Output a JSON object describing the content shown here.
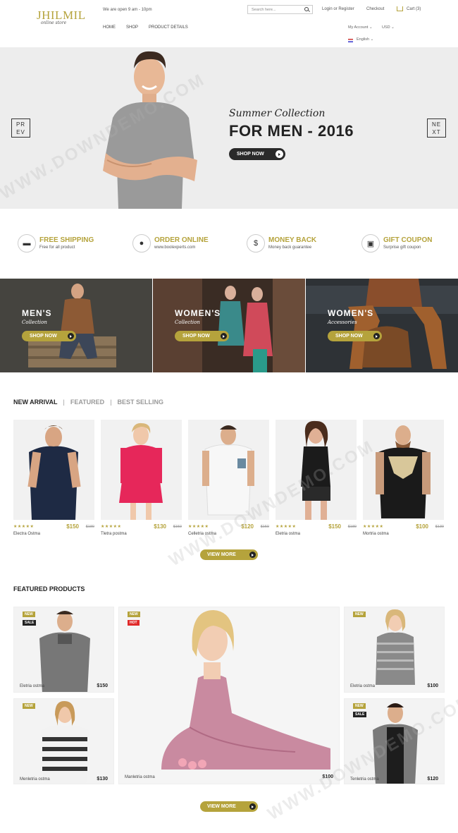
{
  "brand": {
    "logo": "JHILMIL",
    "tagline": "online store",
    "accent": "#b5a33c"
  },
  "header": {
    "open_hours": "We are open 9 am - 10pm",
    "search_placeholder": "Search here...",
    "login": "Login or Register",
    "checkout": "Checkout",
    "cart": "Cart (3)",
    "nav": [
      "HOME",
      "SHOP",
      "PRODUCT DETAILS"
    ],
    "my_account": "My Account",
    "currency": "USD",
    "language": "English"
  },
  "hero": {
    "prev": "PR EV",
    "next": "NE XT",
    "script": "Summer Collection",
    "title": "FOR MEN - 2016",
    "button": "SHOP NOW"
  },
  "services": [
    {
      "icon": "truck-icon",
      "title": "FREE SHIPPING",
      "subtitle": "Free for all product"
    },
    {
      "icon": "user-icon",
      "title": "ORDER ONLINE",
      "subtitle": "www.boolexperts.com"
    },
    {
      "icon": "dollar-icon",
      "title": "MONEY BACK",
      "subtitle": "Money back guarantee"
    },
    {
      "icon": "gift-icon",
      "title": "GIFT COUPON",
      "subtitle": "Surprise gift coupon"
    }
  ],
  "categories": [
    {
      "title": "MEN'S",
      "subtitle": "Collection",
      "button": "SHOP NOW"
    },
    {
      "title": "WOMEN'S",
      "subtitle": "Collection",
      "button": "SHOP NOW"
    },
    {
      "title": "WOMEN'S",
      "subtitle": "Accessories",
      "button": "SHOP NOW"
    }
  ],
  "arrival": {
    "tabs": [
      "NEW ARRIVAL",
      "FEATURED",
      "BEST SELLING"
    ],
    "separator": "|",
    "products": [
      {
        "name": "Electra Ostma",
        "price": "$150",
        "old_price": "$180",
        "rating": 5
      },
      {
        "name": "Tletra postma",
        "price": "$130",
        "old_price": "$150",
        "rating": 5
      },
      {
        "name": "Celletria ostma",
        "price": "$120",
        "old_price": "$150",
        "rating": 5
      },
      {
        "name": "Eletria ostma",
        "price": "$150",
        "old_price": "$180",
        "rating": 5
      },
      {
        "name": "Mortria ostma",
        "price": "$100",
        "old_price": "$130",
        "rating": 5
      }
    ],
    "view_more": "VIEW MORE"
  },
  "featured": {
    "title": "FEATURED PRODUCTS",
    "items": [
      {
        "name": "Eletria ostma",
        "price": "$150",
        "badges": [
          "NEW",
          "SALE"
        ]
      },
      {
        "name": "Menletria ostma",
        "price": "$130",
        "badges": [
          "NEW"
        ]
      },
      {
        "name": "Manletria ostma",
        "price": "$100",
        "badges": [
          "NEW",
          "HOT"
        ]
      },
      {
        "name": "Eletria ostma",
        "price": "$100",
        "badges": [
          "NEW"
        ]
      },
      {
        "name": "Tenletria ostma",
        "price": "$120",
        "badges": [
          "NEW",
          "SALE"
        ]
      }
    ],
    "view_more": "VIEW MORE"
  },
  "watermark": "WWW.DOWNDEMO.COM",
  "star_glyph": "★★★★★"
}
